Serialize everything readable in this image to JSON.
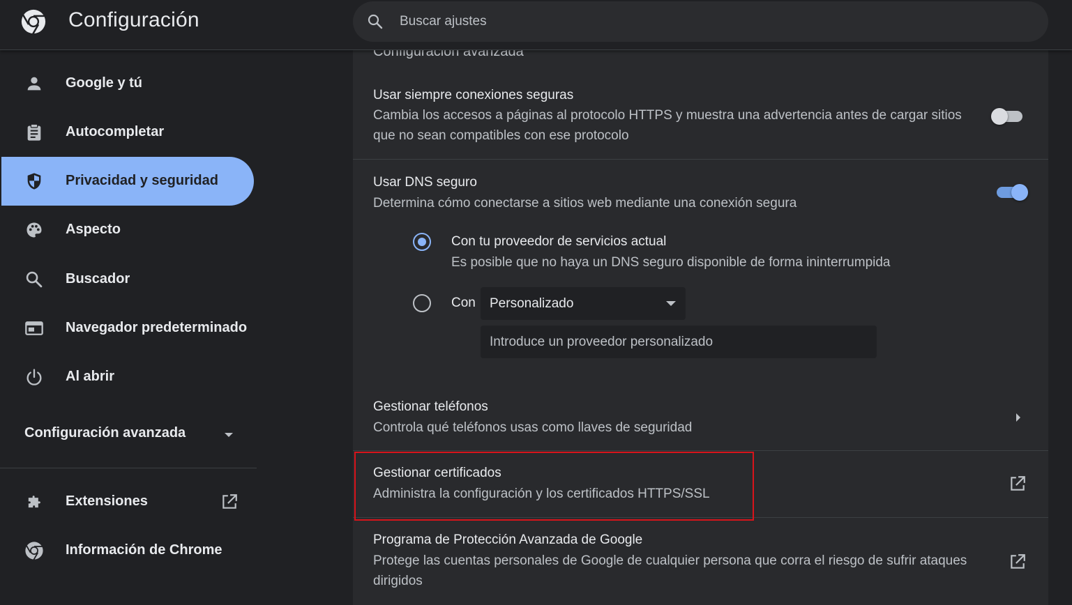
{
  "header": {
    "title": "Configuración",
    "search_placeholder": "Buscar ajustes"
  },
  "sidebar": {
    "items": [
      {
        "label": "Google y tú",
        "icon": "person-icon"
      },
      {
        "label": "Autocompletar",
        "icon": "clipboard-icon"
      },
      {
        "label": "Privacidad y seguridad",
        "icon": "shield-icon",
        "active": true
      },
      {
        "label": "Aspecto",
        "icon": "palette-icon"
      },
      {
        "label": "Buscador",
        "icon": "search-icon"
      },
      {
        "label": "Navegador predeterminado",
        "icon": "browser-window-icon"
      },
      {
        "label": "Al abrir",
        "icon": "power-icon"
      }
    ],
    "advanced_label": "Configuración avanzada",
    "extensions_label": "Extensiones",
    "about_label": "Información de Chrome"
  },
  "main": {
    "cut_section_title": "Configuración avanzada",
    "secure_connections": {
      "title": "Usar siempre conexiones seguras",
      "description": "Cambia los accesos a páginas al protocolo HTTPS y muestra una advertencia antes de cargar sitios que no sean compatibles con ese protocolo",
      "enabled": false
    },
    "secure_dns": {
      "title": "Usar DNS seguro",
      "description": "Determina cómo conectarse a sitios web mediante una conexión segura",
      "enabled": true,
      "option_current": {
        "label": "Con tu proveedor de servicios actual",
        "description": "Es posible que no haya un DNS seguro disponible de forma ininterrumpida",
        "selected": true
      },
      "option_custom": {
        "label": "Con",
        "selected": false,
        "provider_selected": "Personalizado",
        "input_placeholder": "Introduce un proveedor personalizado"
      }
    },
    "manage_phones": {
      "title": "Gestionar teléfonos",
      "description": "Controla qué teléfonos usas como llaves de seguridad"
    },
    "manage_certificates": {
      "title": "Gestionar certificados",
      "description": "Administra la configuración y los certificados HTTPS/SSL"
    },
    "advanced_protection": {
      "title": "Programa de Protección Avanzada de Google",
      "description": "Protege las cuentas personales de Google de cualquier persona que corra el riesgo de sufrir ataques dirigidos"
    }
  },
  "colors": {
    "background": "#202124",
    "card": "#292a2d",
    "accent": "#8ab4f8",
    "text_primary": "#e8eaed",
    "text_secondary": "#bdc1c6",
    "highlight_border": "#d8141b"
  }
}
